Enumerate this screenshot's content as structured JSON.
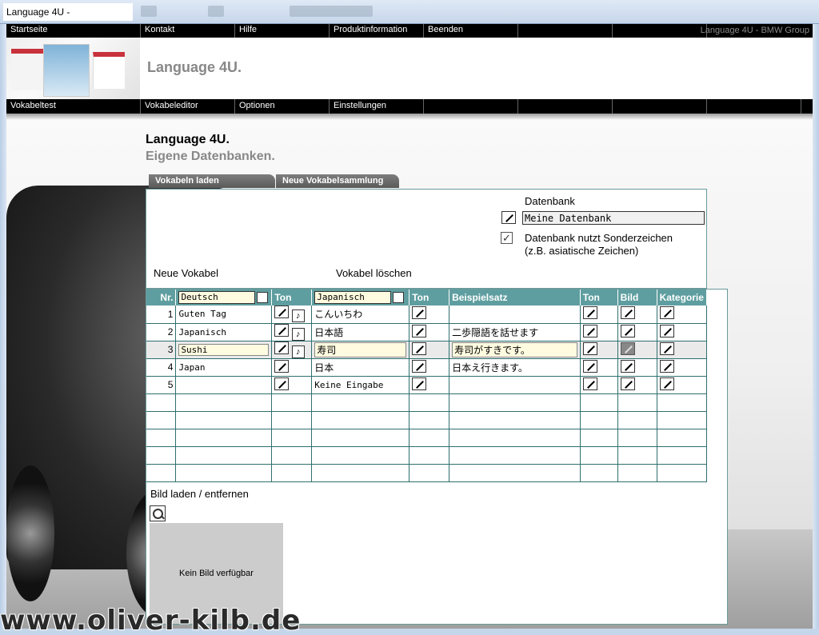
{
  "window": {
    "title": "Language 4U -"
  },
  "topnav": {
    "items": [
      "Startseite",
      "Kontakt",
      "Hilfe",
      "Produktinformation",
      "Beenden",
      "",
      ""
    ],
    "brand": "Language 4U -  BMW Group"
  },
  "header": {
    "app_title": "Language 4U."
  },
  "subnav": {
    "items": [
      "Vokabeltest",
      "Vokabeleditor",
      "Optionen",
      "Einstellungen",
      "",
      "",
      "",
      ""
    ]
  },
  "page": {
    "title": "Language 4U.",
    "subtitle": "Eigene Datenbanken."
  },
  "tabs": [
    "Vokabeln laden",
    "Neue Vokabelsammlung"
  ],
  "panel": {
    "db_label": "Datenbank",
    "db_value": "Meine Datenbank",
    "checkbox_checked": true,
    "checkbox_label_1": "Datenbank nutzt Sonderzeichen",
    "checkbox_label_2": "(z.B. asiatische Zeichen)",
    "new_vocab": "Neue Vokabel",
    "delete_vocab": "Vokabel löschen"
  },
  "table": {
    "headers": {
      "nr": "Nr.",
      "lang1": "Deutsch",
      "ton1": "Ton",
      "lang2": "Japanisch",
      "ton2": "Ton",
      "example": "Beispielsatz",
      "ton3": "Ton",
      "image": "Bild",
      "category": "Kategorie"
    },
    "rows": [
      {
        "nr": "1",
        "de": "Guten Tag",
        "jp": "こんいちわ",
        "example": ""
      },
      {
        "nr": "2",
        "de": "Japanisch",
        "jp": "日本語",
        "example": "二歩隠語を話せます"
      },
      {
        "nr": "3",
        "de": "Sushi",
        "jp": "寿司",
        "example": "寿司がすきです。"
      },
      {
        "nr": "4",
        "de": "Japan",
        "jp": "日本",
        "example": "日本え行きます。"
      },
      {
        "nr": "5",
        "de": "",
        "jp": "Keine Eingabe",
        "example": ""
      }
    ]
  },
  "image_panel": {
    "label": "Bild laden / entfernen",
    "no_image": "Kein Bild verfügbar"
  },
  "watermark": "www.oliver-kilb.de"
}
